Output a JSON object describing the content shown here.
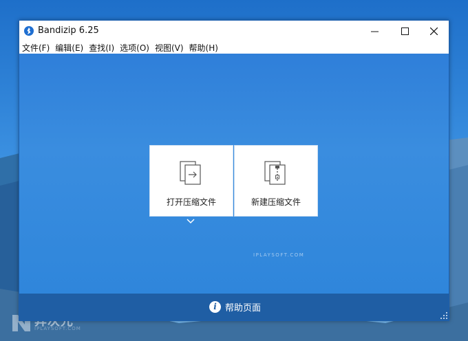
{
  "window": {
    "title": "Bandizip 6.25"
  },
  "menu": [
    "文件(F)",
    "编辑(E)",
    "查找(I)",
    "选项(O)",
    "视图(V)",
    "帮助(H)"
  ],
  "tiles": {
    "open_label": "打开压缩文件",
    "new_label": "新建压缩文件"
  },
  "footer": {
    "help_label": "帮助页面"
  },
  "watermark": {
    "small": "IPLAYSOFT.COM",
    "brand": "异次元",
    "brand_sub": "IPLAYSOFT.COM"
  },
  "colors": {
    "content_bg": "#2f7fd9",
    "footer_bg": "#1f5ea4",
    "tile_bg": "#ffffff"
  }
}
